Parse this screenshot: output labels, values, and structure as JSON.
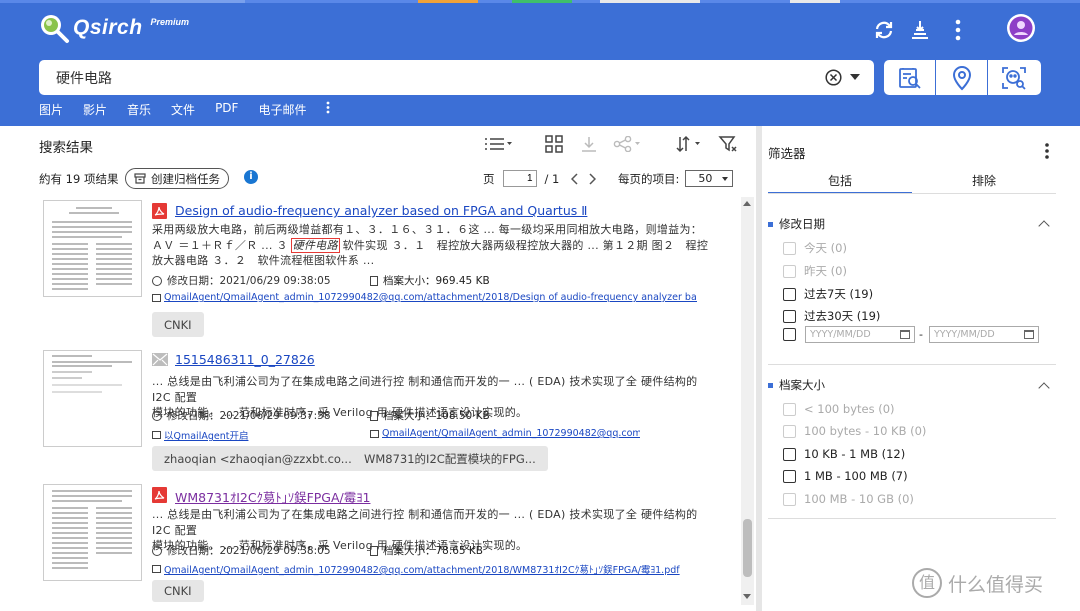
{
  "app": {
    "logo_text": "Qsirch",
    "edition_badge": "Premium"
  },
  "search": {
    "query": "硬件电路"
  },
  "categories": [
    "图片",
    "影片",
    "音乐",
    "文件",
    "PDF",
    "电子邮件"
  ],
  "results_header": {
    "title": "搜索结果",
    "count_text": "約有 19 项结果",
    "archive_button": "创建归档任务",
    "page_label": "页",
    "page_current": "1",
    "page_total": "/ 1",
    "per_page_label": "每页的项目:",
    "per_page_value": "50"
  },
  "results": [
    {
      "title": "Design of audio-frequency analyzer based on FPGA and Quartus Ⅱ",
      "snippet_1": "采用两级放大电路，前后两级增益都有１、３．１６、３１．６这 ... 每一级均采用同相放大电路，则增益为：ＡＶ ＝１＋Ｒｆ／Ｒ ... ３",
      "snippet_hl": "硬件电路",
      "snippet_2": "软件实现 ３．１　程控放大器两级程控放大器的 ... 第１２期 图２　程控放大器电路 ３．２　软件流程框图软件系 ...",
      "modified": "修改日期：2021/06/29 09:38:05",
      "size": "档案大小：969.45 KB",
      "path": "QmailAgent/QmailAgent_admin_1072990482@qq.com/attachment/2018/Design of audio-frequency analyzer based on",
      "tags": [
        "CNKI"
      ]
    },
    {
      "title": "1515486311_0_27826",
      "snippet_1": "... 总线是由飞利浦公司为了在集成电路之间进行控 制和通信而开发的一 ... ( EDA) 技术实现了全 硬件结构的 I2C 配置",
      "snippet_2": "模块的功能。 ... 范和标准时序，采 Verilog 用 硬件描述语言设计实现的。",
      "modified": "修改日期：2021/06/29 09:37:58",
      "size": "档案大小：108.50 KB",
      "open_link": "以QmailAgent开启",
      "path": "QmailAgent/QmailAgent_admin_1072990482@qq.com...",
      "tags": [
        "zhaoqian <zhaoqian@zzxbt.co...",
        "WM8731的I2C配置模块的FPG..."
      ]
    },
    {
      "title": "WM8731ｵI2Cｸ䓪ﾄ｣ｿ鋘FPGA/霉ﾖ1",
      "snippet_1": "... 总线是由飞利浦公司为了在集成电路之间进行控 制和通信而开发的一 ... ( EDA) 技术实现了全 硬件结构的 I2C 配置",
      "snippet_2": "模块的功能。 ... 范和标准时序，采 Verilog 用 硬件描述语言设计实现的。",
      "modified": "修改日期：2021/06/29 09:38:05",
      "size": "档案大小：78.65 KB",
      "path": "QmailAgent/QmailAgent_admin_1072990482@qq.com/attachment/2018/WM8731ｵI2Cｸ䓪ﾄ｣ｿ鋘FPGA/霉ﾖ1.pdf",
      "tags": [
        "CNKI"
      ]
    }
  ],
  "filter": {
    "title": "筛选器",
    "tab_include": "包括",
    "tab_exclude": "排除",
    "date_section": "修改日期",
    "date_options": [
      "今天 (0)",
      "昨天 (0)",
      "过去7天 (19)",
      "过去30天 (19)"
    ],
    "date_from_placeholder": "YYYY/MM/DD",
    "date_to_placeholder": "YYYY/MM/DD",
    "date_sep": "-",
    "size_section": "档案大小",
    "size_options": [
      "< 100 bytes (0)",
      "100 bytes - 10 KB (0)",
      "10 KB - 1 MB (12)",
      "1 MB - 100 MB (7)",
      "100 MB - 10 GB (0)"
    ]
  },
  "watermark": {
    "text": "什么值得买",
    "glyph": "值"
  },
  "colors": {
    "header_bg": "#3c6fd6",
    "link": "#1a47c2",
    "pdf_red": "#e53935",
    "highlight_box": "#e53935"
  },
  "icons": [
    "search-logo-icon",
    "refresh-icon",
    "queue-icon",
    "more-vertical-icon",
    "user-avatar-icon",
    "clear-icon",
    "dropdown-icon",
    "image-search-icon",
    "location-icon",
    "face-search-icon",
    "list-view-icon",
    "grid-view-icon",
    "download-icon",
    "share-icon",
    "sort-icon",
    "filter-icon",
    "archive-icon",
    "info-icon",
    "pdf-icon",
    "email-icon",
    "calendar-icon"
  ]
}
